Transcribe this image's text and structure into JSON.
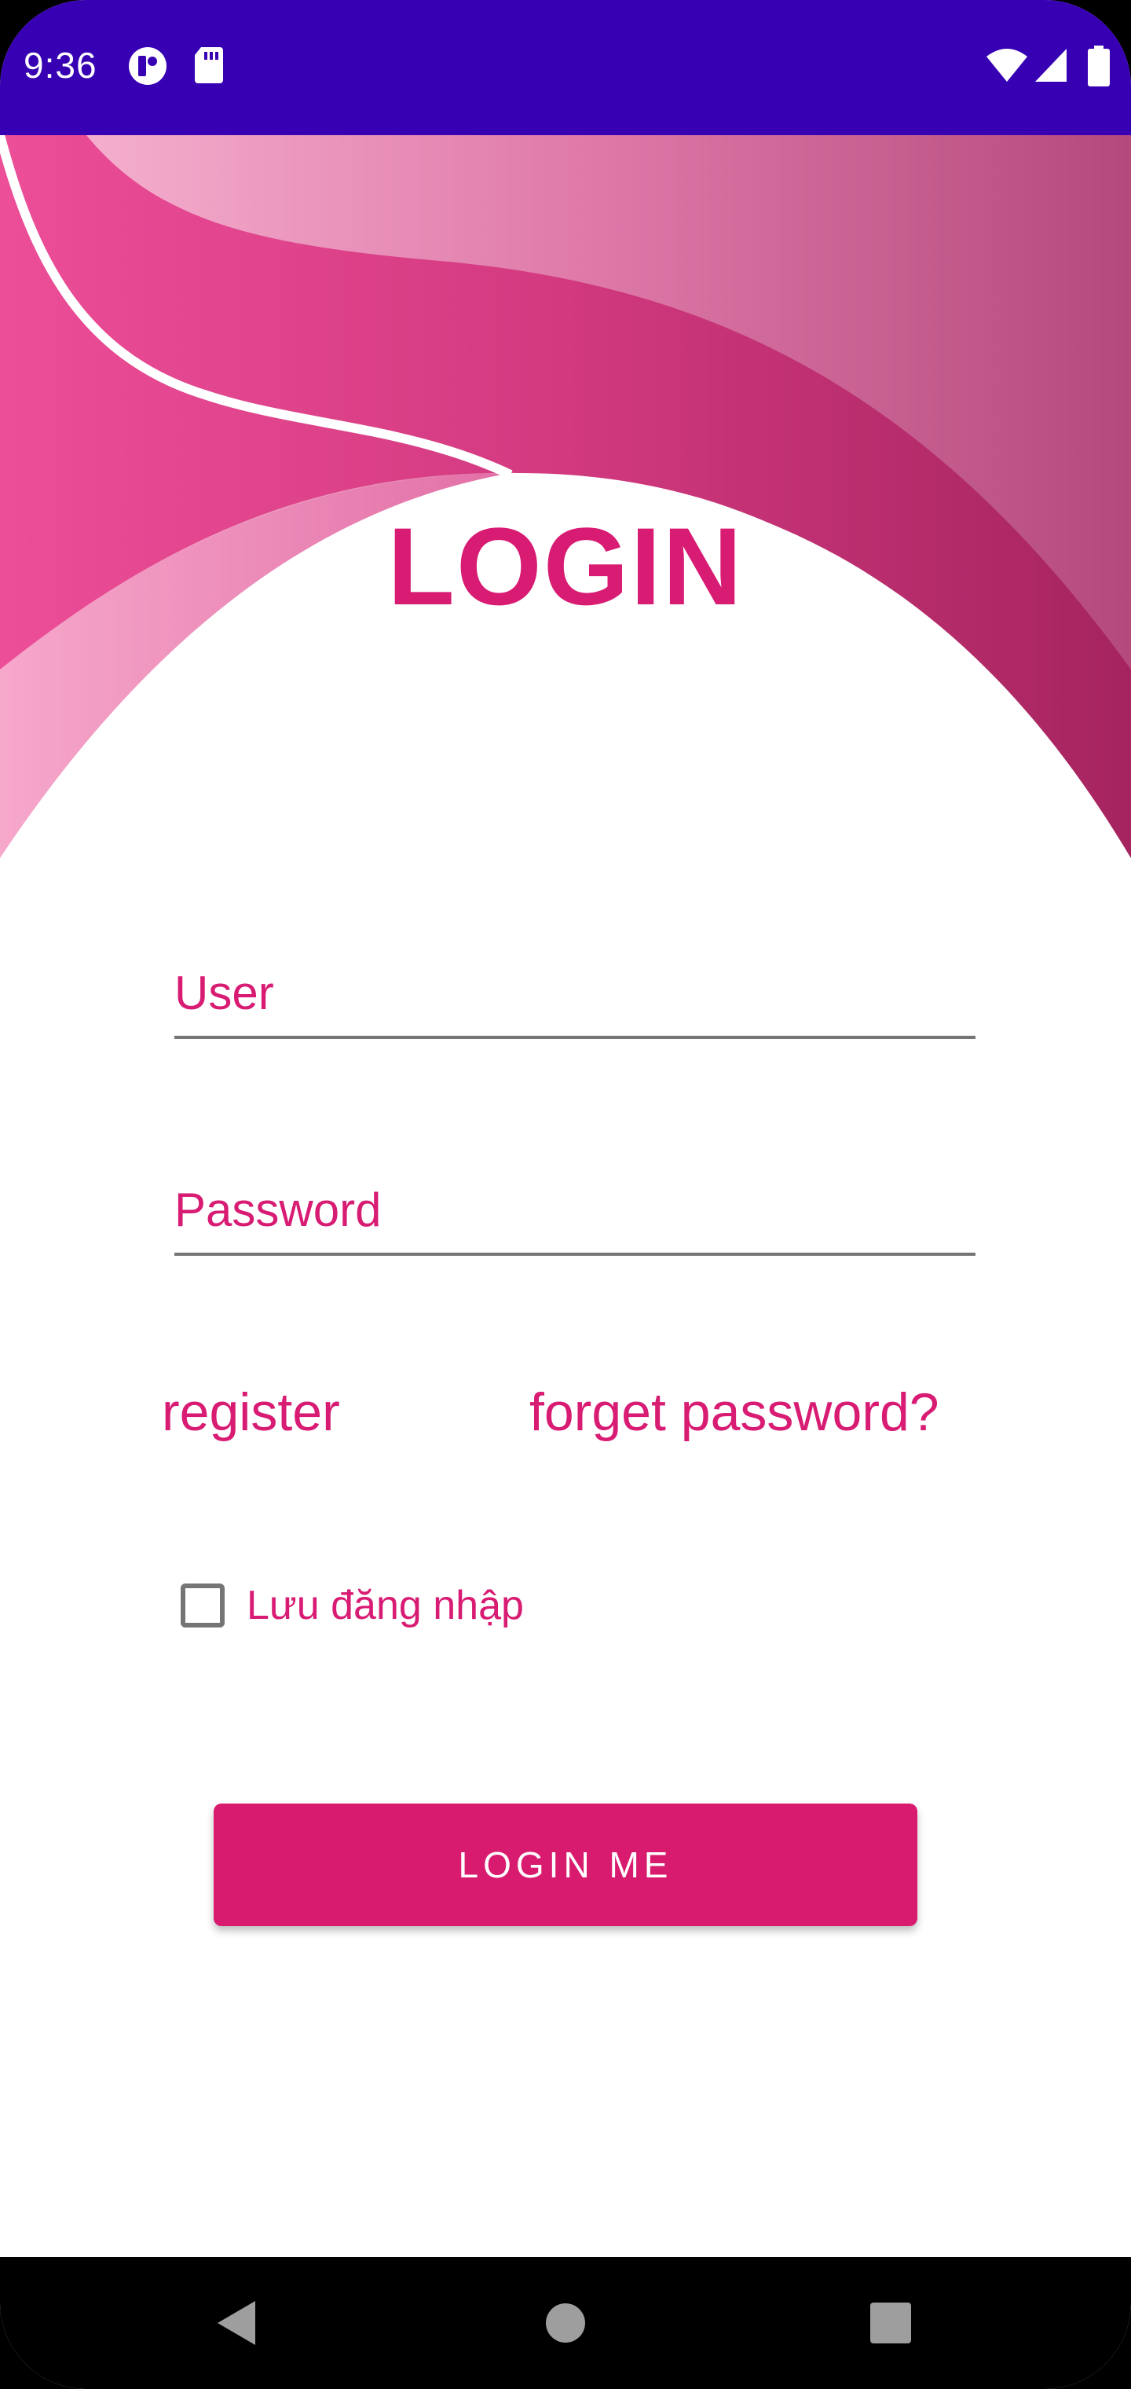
{
  "status_bar": {
    "time": "9:36",
    "icons": [
      "notification-app-icon",
      "sd-card-icon",
      "wifi-icon",
      "cell-signal-icon",
      "battery-icon"
    ],
    "background": "#3700B3"
  },
  "header": {
    "title": "LOGIN",
    "accent": "#D81B73"
  },
  "form": {
    "user_placeholder": "User",
    "password_placeholder": "Password",
    "user_value": "",
    "password_value": ""
  },
  "links": {
    "register": "register",
    "forget_password": "forget password?"
  },
  "remember": {
    "label": "Lưu đăng nhập",
    "checked": false
  },
  "actions": {
    "login_label": "LOGIN ME",
    "button_color": "#D81B6F"
  },
  "nav_bar": {
    "buttons": [
      "back-icon",
      "home-icon",
      "recents-icon"
    ]
  }
}
